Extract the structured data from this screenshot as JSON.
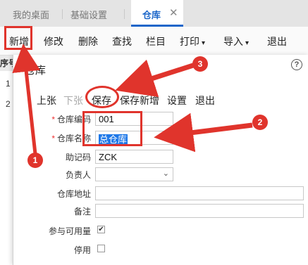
{
  "tabs": [
    {
      "label": "我的桌面"
    },
    {
      "label": "基础设置"
    },
    {
      "label": "仓库",
      "close": "✕"
    }
  ],
  "toolbar": {
    "items": [
      {
        "label": "新增"
      },
      {
        "label": "修改"
      },
      {
        "label": "删除"
      },
      {
        "label": "查找"
      },
      {
        "label": "栏目"
      },
      {
        "label": "打印",
        "caret": "▾"
      },
      {
        "label": "导入",
        "caret": "▾"
      },
      {
        "label": "退出"
      }
    ]
  },
  "background_table": {
    "header": "序号",
    "rows": [
      "1",
      "2"
    ]
  },
  "dialog": {
    "title": "仓库",
    "help_icon": "?",
    "toolbar": {
      "items": [
        {
          "label": "上张"
        },
        {
          "label": "下张"
        },
        {
          "label": "保存"
        },
        {
          "label": "保存新增"
        },
        {
          "label": "设置"
        },
        {
          "label": "退出"
        }
      ]
    },
    "form": {
      "required_mark": "*",
      "code": {
        "label": "仓库编码",
        "value": "001"
      },
      "name": {
        "label": "仓库名称",
        "value": "总仓库"
      },
      "mnemonic": {
        "label": "助记码",
        "value": "ZCK"
      },
      "manager": {
        "label": "负责人",
        "value": ""
      },
      "address": {
        "label": "仓库地址",
        "value": ""
      },
      "remark": {
        "label": "备注",
        "value": ""
      },
      "available": {
        "label": "参与可用量",
        "checked": true,
        "mark": "✔"
      },
      "disabled": {
        "label": "停用",
        "checked": false
      }
    }
  },
  "annotations": {
    "badge_1": "1",
    "badge_2": "2",
    "badge_3": "3",
    "color": "#e0342c"
  },
  "colors": {
    "active_tab": "#1b66c9",
    "selection": "#1e78e8"
  }
}
